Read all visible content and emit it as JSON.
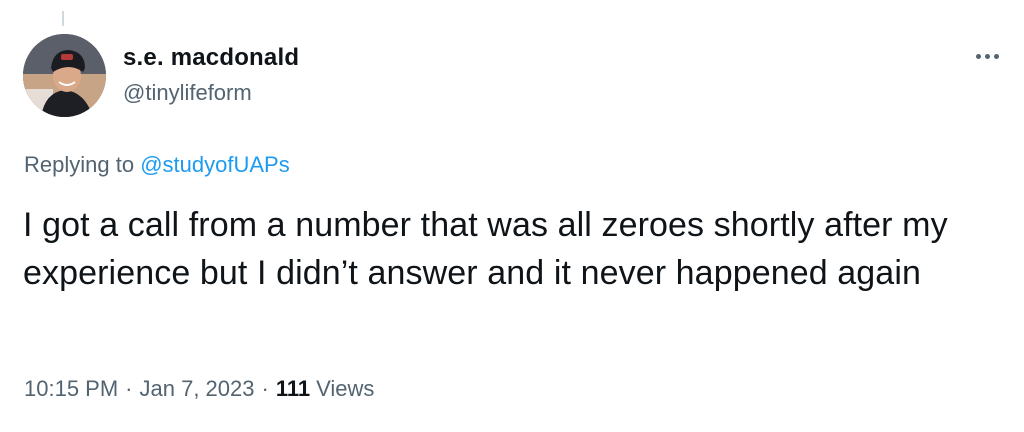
{
  "user": {
    "display_name": "s.e. macdonald",
    "handle": "@tinylifeform"
  },
  "reply": {
    "prefix": "Replying to",
    "mention": "@studyofUAPs"
  },
  "tweet": {
    "text": "I got a call from a number that was all zeroes shortly after my experience but I didn’t answer and it never happened again"
  },
  "meta": {
    "time": "10:15 PM",
    "separator": "·",
    "date": "Jan 7, 2023",
    "views_count": "111",
    "views_label": "Views"
  },
  "icons": {
    "more": "more-horizontal-icon"
  },
  "colors": {
    "text_primary": "#0f1419",
    "text_secondary": "#536471",
    "link": "#1d9bf0",
    "thread_line": "#cfd9de"
  }
}
